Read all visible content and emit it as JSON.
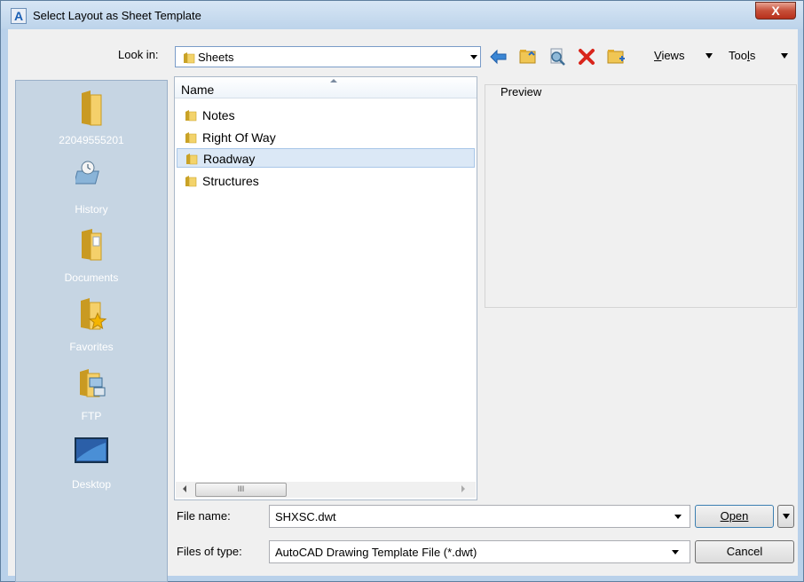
{
  "window": {
    "title": "Select Layout as Sheet Template",
    "app_icon_letter": "A",
    "close_glyph": "X"
  },
  "lookin": {
    "label": "Look in:",
    "value": "Sheets"
  },
  "toolbar": {
    "icons": [
      "back-icon",
      "up-folder-icon",
      "search-web-icon",
      "delete-icon",
      "new-folder-icon"
    ],
    "views_label": "Views",
    "tools_label": "Tools"
  },
  "places": [
    {
      "label": "22049555201",
      "icon": "folder-icon"
    },
    {
      "label": "History",
      "icon": "history-icon"
    },
    {
      "label": "Documents",
      "icon": "documents-icon"
    },
    {
      "label": "Favorites",
      "icon": "favorites-icon"
    },
    {
      "label": "FTP",
      "icon": "ftp-icon"
    },
    {
      "label": "Desktop",
      "icon": "desktop-icon"
    }
  ],
  "filelist": {
    "header": "Name",
    "items": [
      {
        "name": "Notes",
        "selected": false
      },
      {
        "name": "Right Of Way",
        "selected": false
      },
      {
        "name": "Roadway",
        "selected": true
      },
      {
        "name": "Structures",
        "selected": false
      }
    ],
    "scroll_thumb_glyph": "III"
  },
  "preview": {
    "label": "Preview"
  },
  "filename": {
    "label": "File name:",
    "value": "SHXSC.dwt"
  },
  "filetype": {
    "label": "Files of type:",
    "value": "AutoCAD Drawing Template File (*.dwt)"
  },
  "buttons": {
    "open": "Open",
    "cancel": "Cancel"
  },
  "colors": {
    "title_bar": "#bcd3ea",
    "places_bg": "#c6d5e3",
    "selection": "#dbe8f6",
    "close_button": "#c7503a"
  }
}
